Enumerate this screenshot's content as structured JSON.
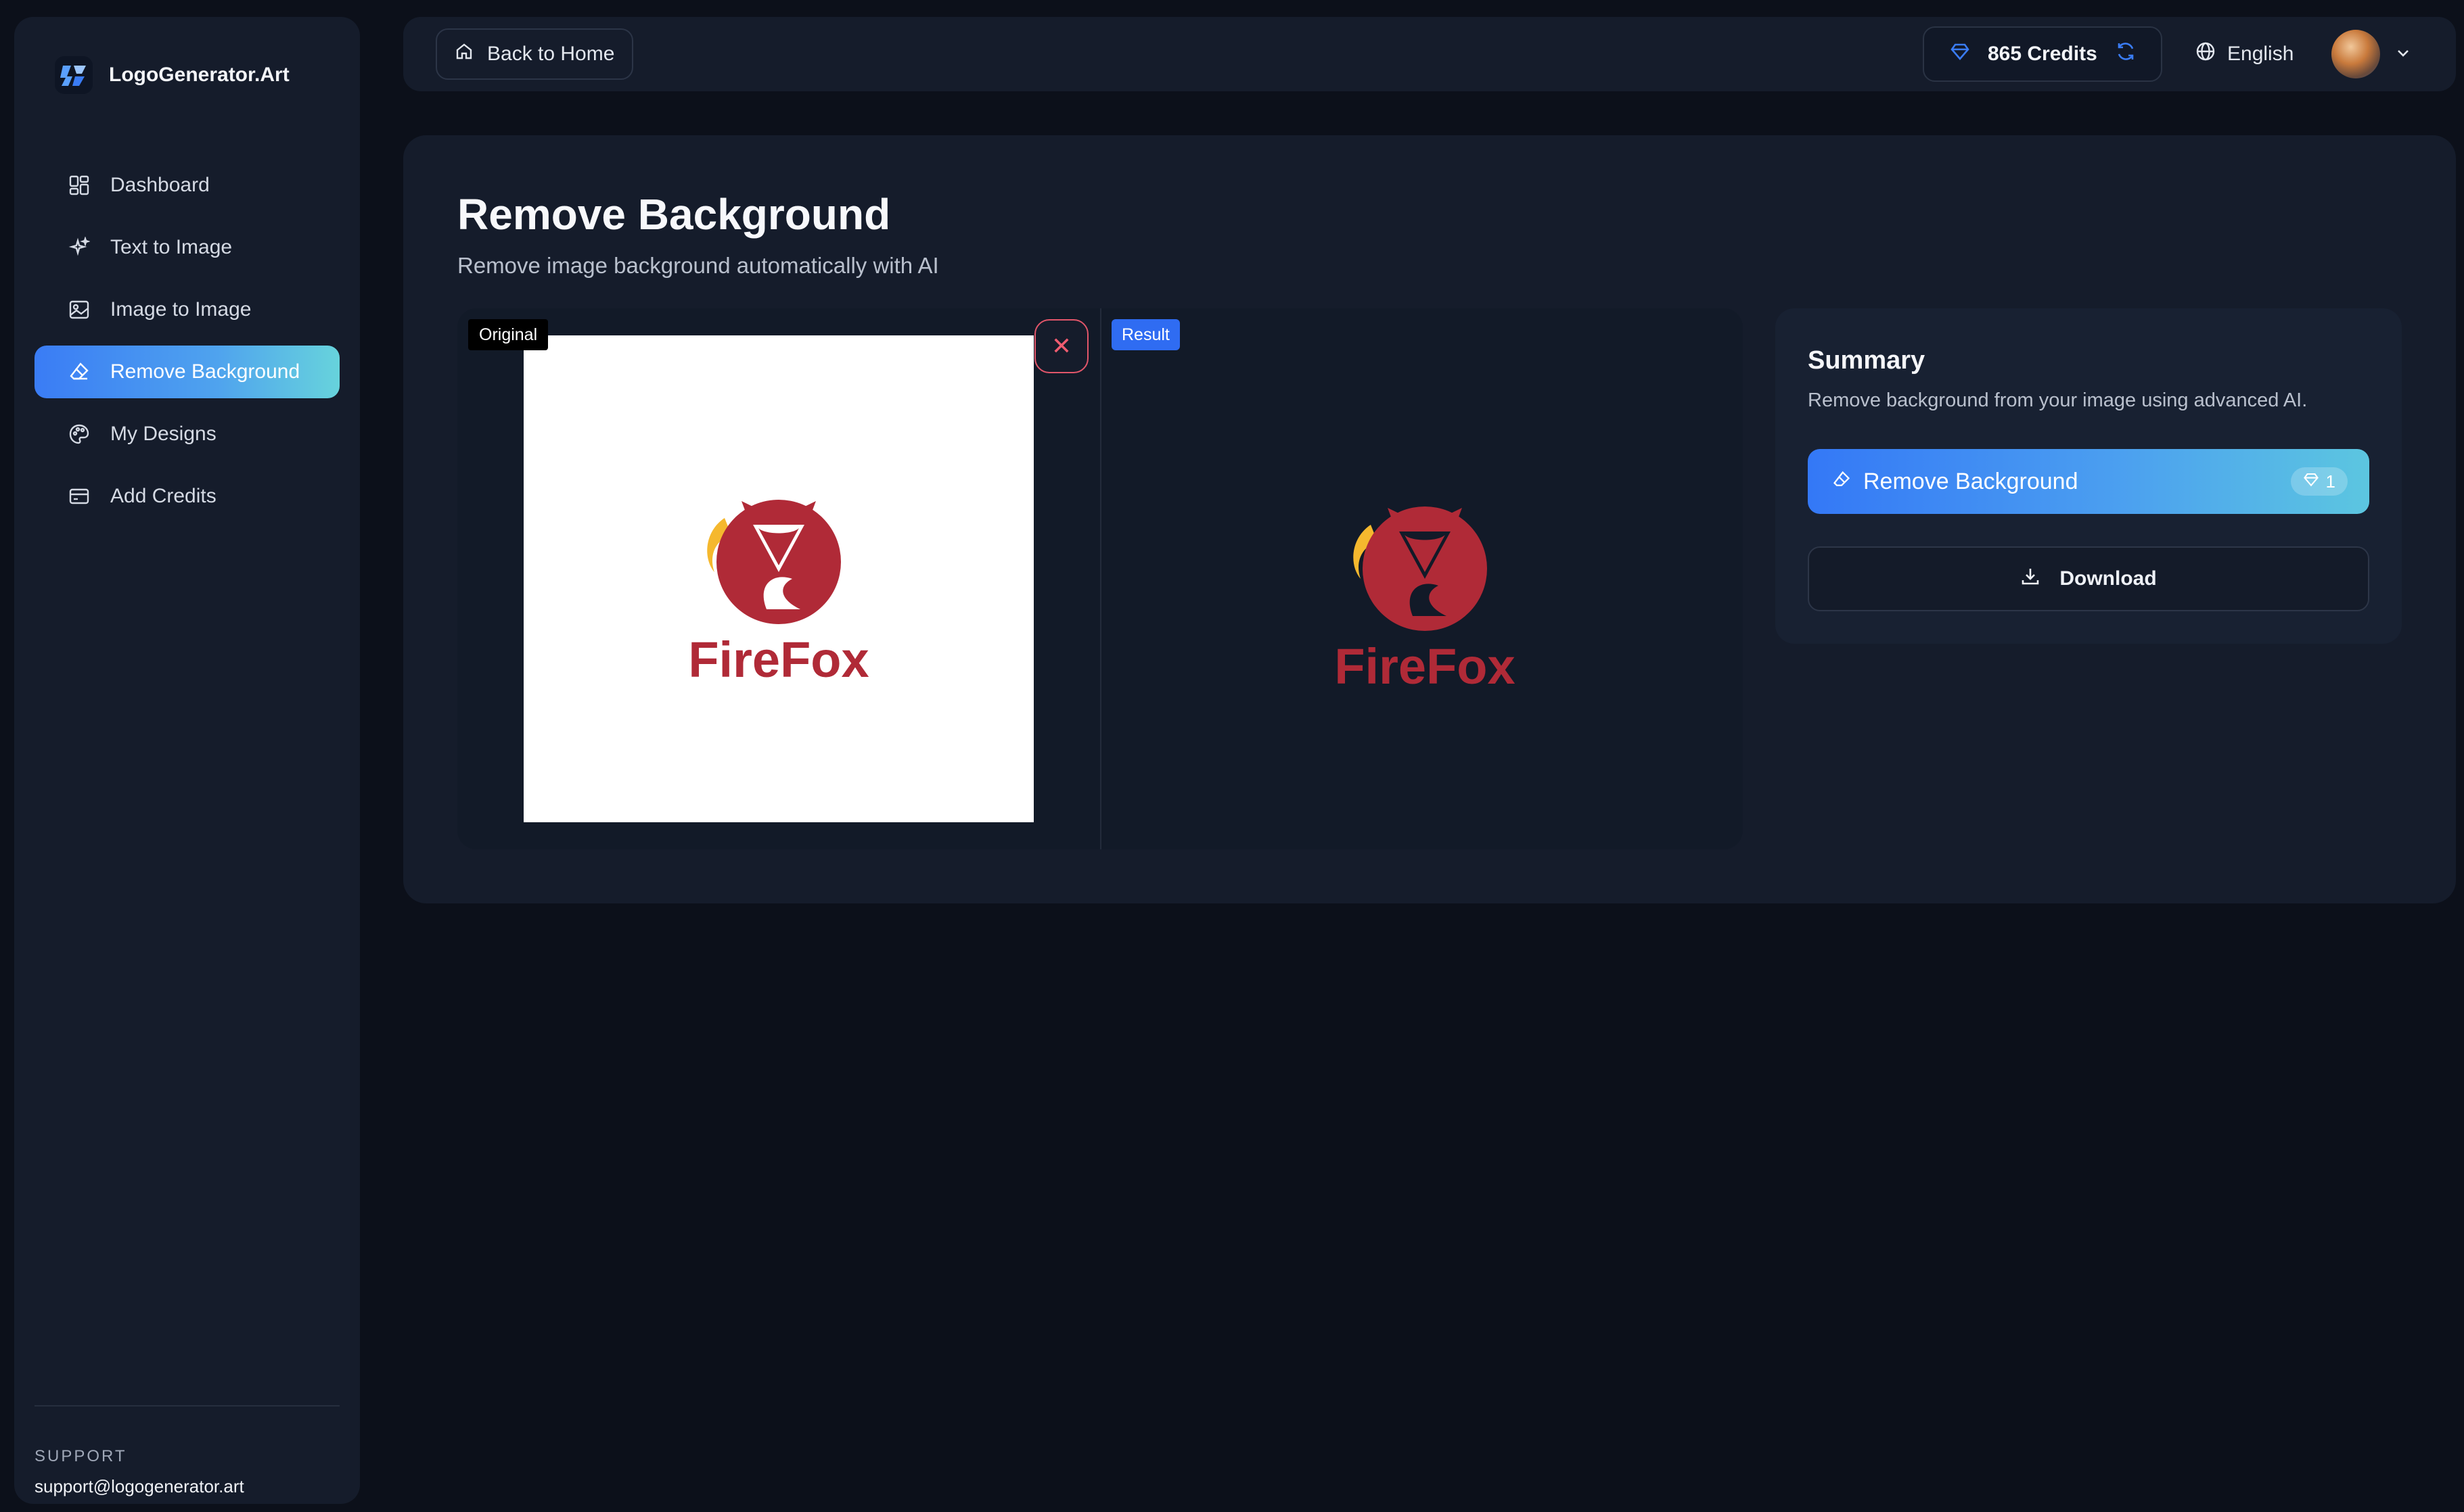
{
  "brand": {
    "name": "LogoGenerator.Art"
  },
  "sidebar": {
    "items": [
      {
        "label": "Dashboard",
        "icon": "dashboard-icon"
      },
      {
        "label": "Text to Image",
        "icon": "sparkles-icon"
      },
      {
        "label": "Image to Image",
        "icon": "image-icon"
      },
      {
        "label": "Remove Background",
        "icon": "eraser-icon",
        "active": true
      },
      {
        "label": "My Designs",
        "icon": "palette-icon"
      },
      {
        "label": "Add Credits",
        "icon": "credit-card-icon"
      }
    ],
    "support_label": "SUPPORT",
    "support_email": "support@logogenerator.art"
  },
  "topbar": {
    "back_label": "Back to Home",
    "credits_label": "865 Credits",
    "language": "English"
  },
  "page": {
    "title": "Remove Background",
    "subtitle": "Remove image background automatically with AI"
  },
  "compare": {
    "original_tag": "Original",
    "result_tag": "Result",
    "logo_text": "FireFox"
  },
  "summary": {
    "title": "Summary",
    "description": "Remove background from your image using advanced AI.",
    "remove_button": "Remove Background",
    "cost": "1",
    "download_button": "Download"
  },
  "colors": {
    "accent": "#3a7cf5",
    "accent_end": "#67d3dc",
    "logo_red": "#b02a37",
    "logo_flame": "#f5b82e",
    "danger": "#e2566a"
  }
}
